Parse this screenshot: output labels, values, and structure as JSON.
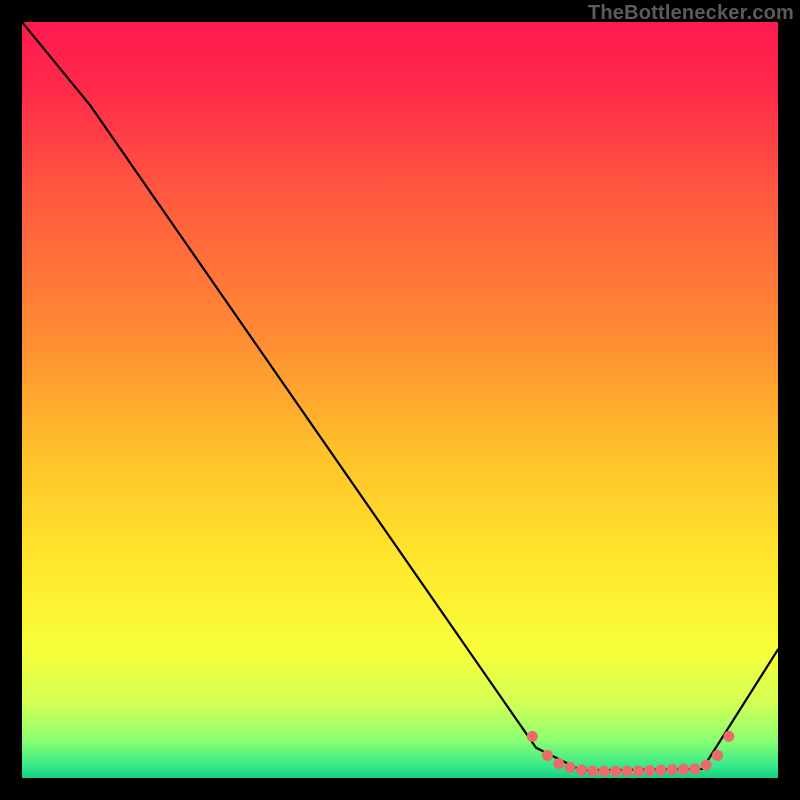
{
  "watermark": "TheBottlenecker.com",
  "chart_data": {
    "type": "line",
    "title": "",
    "xlabel": "",
    "ylabel": "",
    "xlim": [
      0,
      100
    ],
    "ylim": [
      0,
      100
    ],
    "grid": false,
    "series": [
      {
        "name": "bottleneck-curve",
        "x": [
          0,
          9,
          68,
          74,
          90,
          100
        ],
        "y": [
          100,
          89,
          4,
          1,
          1.2,
          17
        ]
      }
    ],
    "markers": {
      "name": "highlight-dots",
      "points": [
        [
          67.5,
          5.5
        ],
        [
          69.5,
          3.0
        ],
        [
          71.0,
          1.9
        ],
        [
          72.5,
          1.4
        ],
        [
          74.0,
          1.05
        ],
        [
          75.5,
          0.95
        ],
        [
          77.0,
          0.9
        ],
        [
          78.5,
          0.9
        ],
        [
          80.0,
          0.92
        ],
        [
          81.5,
          0.95
        ],
        [
          83.0,
          1.0
        ],
        [
          84.5,
          1.05
        ],
        [
          86.0,
          1.1
        ],
        [
          87.5,
          1.15
        ],
        [
          89.0,
          1.2
        ],
        [
          90.5,
          1.7
        ],
        [
          92.0,
          3.0
        ],
        [
          93.5,
          5.5
        ]
      ]
    },
    "gradient_stops": [
      {
        "offset": 0.0,
        "color": "#ff1a4f"
      },
      {
        "offset": 0.09,
        "color": "#ff2a4a"
      },
      {
        "offset": 0.23,
        "color": "#ff5a3f"
      },
      {
        "offset": 0.41,
        "color": "#ff8a33"
      },
      {
        "offset": 0.58,
        "color": "#ffc42a"
      },
      {
        "offset": 0.72,
        "color": "#ffe82d"
      },
      {
        "offset": 0.83,
        "color": "#f8ff3a"
      },
      {
        "offset": 0.9,
        "color": "#d4ff55"
      },
      {
        "offset": 0.95,
        "color": "#8cff70"
      },
      {
        "offset": 0.985,
        "color": "#34e88a"
      },
      {
        "offset": 1.0,
        "color": "#16d080"
      }
    ]
  }
}
